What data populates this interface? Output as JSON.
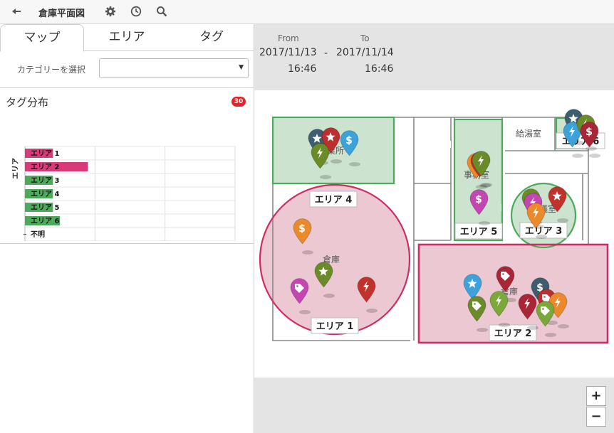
{
  "toolbar": {
    "back_icon": "back-arrow-icon",
    "title": "倉庫平面図",
    "settings_icon": "gear-icon",
    "history_icon": "clock-icon",
    "search_icon": "search-icon"
  },
  "tabs": [
    {
      "label": "マップ",
      "active": true
    },
    {
      "label": "エリア",
      "active": false
    },
    {
      "label": "タグ",
      "active": false
    }
  ],
  "category": {
    "label": "カテゴリーを選択",
    "value": ""
  },
  "tag_distribution": {
    "title": "タグ分布",
    "count": "30"
  },
  "chart_data": {
    "type": "bar",
    "orientation": "horizontal",
    "ylabel": "エリア",
    "categories": [
      "エリア 1",
      "エリア 2",
      "エリア 3",
      "エリア 4",
      "エリア 5",
      "エリア 6",
      "不明"
    ],
    "values": [
      4,
      9,
      4,
      4,
      4,
      5,
      0
    ],
    "colors": [
      "#d93a78",
      "#d93a78",
      "#4caa5a",
      "#4caa5a",
      "#4caa5a",
      "#4caa5a",
      "#4caa5a"
    ],
    "xlim": [
      0,
      30
    ],
    "xticks": [
      "0",
      "10",
      "20",
      "30"
    ],
    "grid": true
  },
  "daterange": {
    "from_label": "From",
    "to_label": "To",
    "from_date": "2017/11/13",
    "from_time": "16:46",
    "separator": "-",
    "to_date": "2017/11/14",
    "to_time": "16:46"
  },
  "map": {
    "rooms": [
      "給湯室",
      "作業所",
      "事務室",
      "会議室",
      "倉庫",
      "倉庫"
    ],
    "areas": [
      "エリア 1",
      "エリア 2",
      "エリア 3",
      "エリア 4",
      "エリア 5",
      "エリア 6"
    ],
    "colors": {
      "pink": "#d93a78",
      "green": "#4caa5a"
    }
  },
  "zoom": {
    "in": "+",
    "out": "−"
  }
}
